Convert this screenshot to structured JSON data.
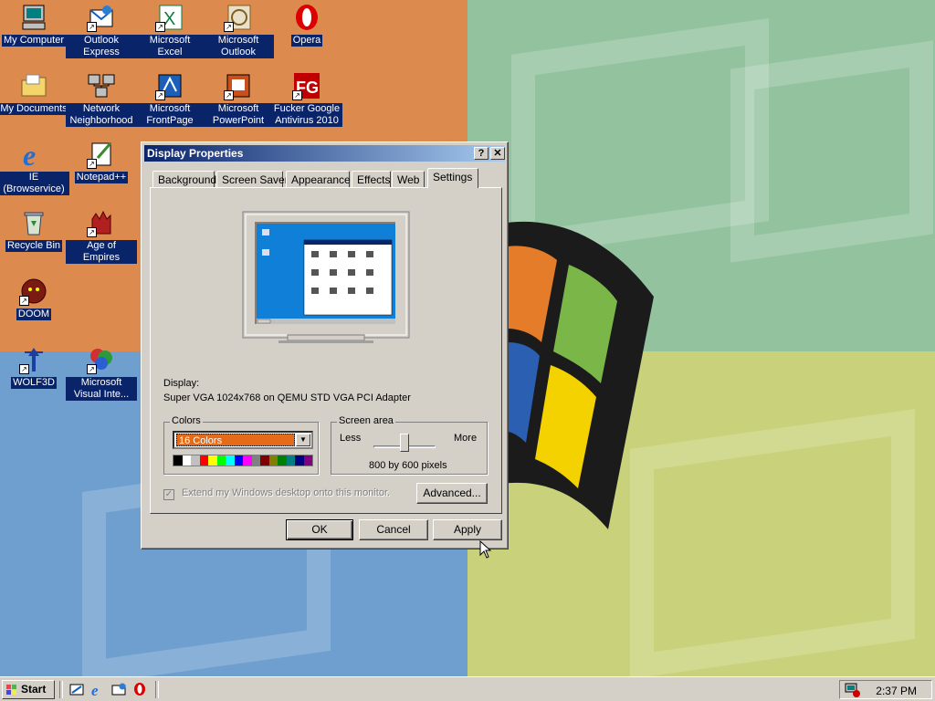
{
  "desktop": {
    "icons": [
      {
        "label": "My Computer",
        "icon": "computer-icon"
      },
      {
        "label": "Outlook Express",
        "icon": "outlook-express-icon"
      },
      {
        "label": "Microsoft Excel",
        "icon": "excel-icon"
      },
      {
        "label": "Microsoft Outlook",
        "icon": "outlook-icon"
      },
      {
        "label": "Opera",
        "icon": "opera-icon"
      },
      {
        "label": "My Documents",
        "icon": "folder-icon"
      },
      {
        "label": "Network Neighborhood",
        "icon": "network-icon"
      },
      {
        "label": "Microsoft FrontPage",
        "icon": "frontpage-icon"
      },
      {
        "label": "Microsoft PowerPoint",
        "icon": "powerpoint-icon"
      },
      {
        "label": "Fucker Google Antivirus 2010",
        "icon": "antivirus-icon"
      },
      {
        "label": "IE (Browservice)",
        "icon": "ie-icon"
      },
      {
        "label": "Notepad++",
        "icon": "notepad-icon"
      },
      {
        "label": "Recycle Bin",
        "icon": "recycle-bin-icon"
      },
      {
        "label": "Age of Empires",
        "icon": "age-of-empires-icon"
      },
      {
        "label": "DOOM",
        "icon": "doom-icon"
      },
      {
        "label": "WOLF3D",
        "icon": "wolf3d-icon"
      },
      {
        "label": "Microsoft Visual Inte...",
        "icon": "visual-interdev-icon"
      }
    ]
  },
  "dialog": {
    "title": "Display Properties",
    "help_btn": "?",
    "close_btn": "✕",
    "tabs": [
      "Background",
      "Screen Saver",
      "Appearance",
      "Effects",
      "Web",
      "Settings"
    ],
    "active_tab": "Settings",
    "display_label": "Display:",
    "display_value": "Super VGA 1024x768 on QEMU STD VGA PCI Adapter",
    "colors": {
      "group_title": "Colors",
      "selected": "16 Colors",
      "arrow": "▼"
    },
    "screen_area": {
      "group_title": "Screen area",
      "less": "Less",
      "more": "More",
      "resolution": "800 by 600 pixels",
      "level_fraction": 0.5
    },
    "extend_checkbox_label": "Extend my Windows desktop onto this monitor.",
    "extend_checkbox_mark": "✓",
    "advanced_btn": "Advanced...",
    "ok_btn": "OK",
    "cancel_btn": "Cancel",
    "apply_btn": "Apply"
  },
  "taskbar": {
    "start_label": "Start",
    "clock": "2:37 PM"
  },
  "colors": {
    "title_active": "#0a246a",
    "face": "#d4d0c8",
    "selection": "#e46b1a"
  }
}
